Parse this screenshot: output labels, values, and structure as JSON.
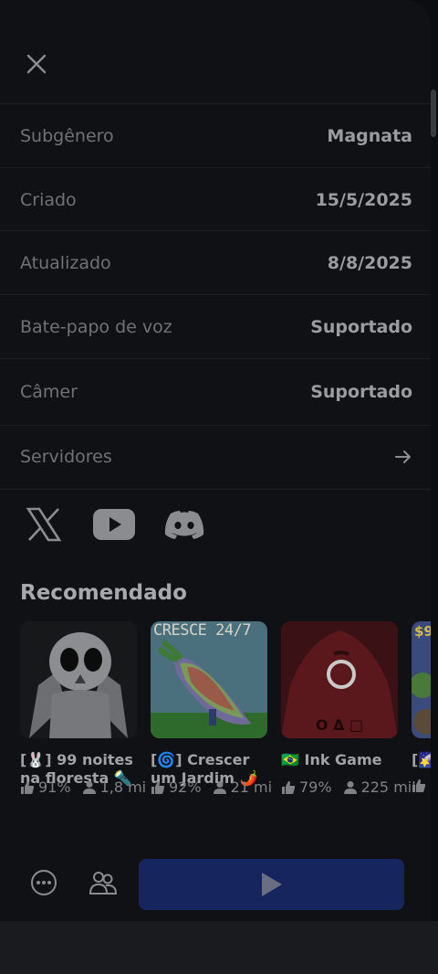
{
  "details": [
    {
      "key": "Subgênero",
      "value": "Magnata"
    },
    {
      "key": "Criado",
      "value": "15/5/2025"
    },
    {
      "key": "Atualizado",
      "value": "8/8/2025"
    },
    {
      "key": "Bate-papo de voz",
      "value": "Suportado"
    },
    {
      "key": "Câmer",
      "value": "Suportado"
    }
  ],
  "servers_label": "Servidores",
  "social_icons": [
    "x-icon",
    "youtube-icon",
    "discord-icon"
  ],
  "recommended_title": "Recomendado",
  "recommended": [
    {
      "title": "[🐰] 99 noites na floresta 🔦",
      "likes": "91%",
      "players": "1,8 mi"
    },
    {
      "title": "[🌀] Crescer um Jardim 🌶️",
      "likes": "92%",
      "players": "21 mi"
    },
    {
      "title": "🇧🇷 Ink Game",
      "likes": "79%",
      "players": "225 mil"
    },
    {
      "title": "[🌠] Bra",
      "likes": "",
      "players": ""
    }
  ],
  "thumb_texts": {
    "grow": "CRESCE 24/7",
    "ink": "Ο Δ □",
    "partial": "$9"
  },
  "colors": {
    "play_button": "#16255e",
    "background": "#101114"
  }
}
